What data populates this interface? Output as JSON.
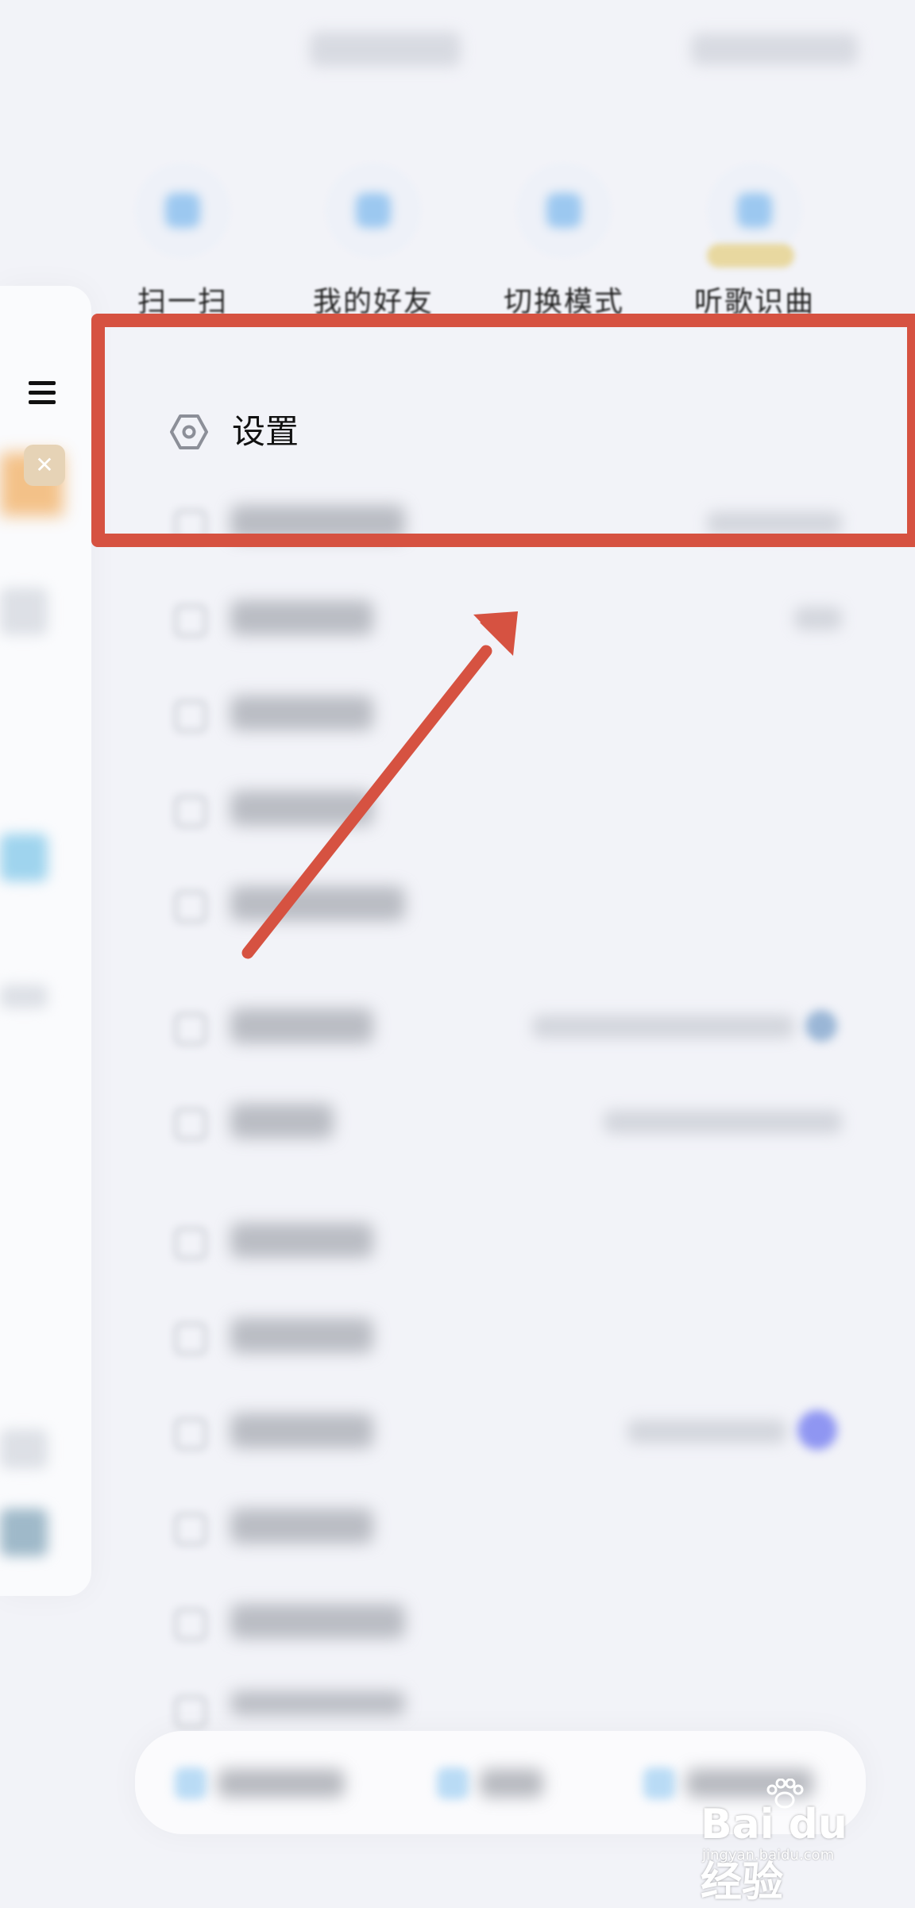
{
  "quick_actions": [
    {
      "label": "扫一扫",
      "icon": "scan-icon"
    },
    {
      "label": "我的好友",
      "icon": "friends-icon"
    },
    {
      "label": "切换模式",
      "icon": "switch-mode-icon"
    },
    {
      "label": "听歌识曲",
      "icon": "music-recognize-icon"
    }
  ],
  "settings": {
    "label": "设置",
    "icon": "hexagon-gear-icon"
  },
  "watermark": {
    "text": "Bai du 经验",
    "sub": "jingyan.baidu.com"
  },
  "colors": {
    "annotation": "#d65241",
    "background": "#f2f3f8",
    "accent_dot": "#8f96f2"
  }
}
